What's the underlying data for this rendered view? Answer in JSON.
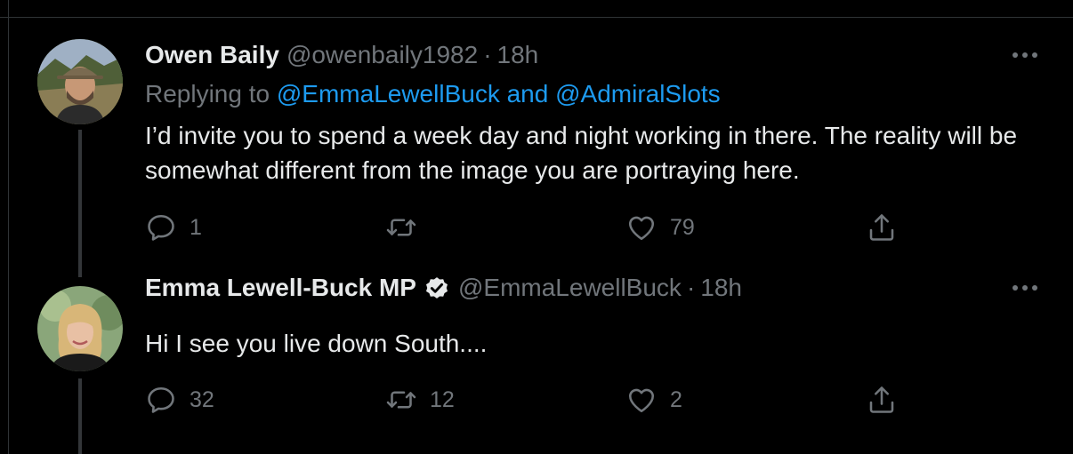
{
  "tweets": [
    {
      "author_name": "Owen Baily",
      "author_handle": "@owenbaily1982",
      "separator": "·",
      "time": "18h",
      "replying_to_prefix": "Replying to",
      "replying_to_mentions": "@EmmaLewellBuck and @AdmiralSlots",
      "text": "I’d invite you to spend a week day and night working in there. The reality will be somewhat different from the image you are portraying here.",
      "reply_count": "1",
      "retweet_count": "",
      "like_count": "79",
      "verified": false,
      "avatar_icon": "man-with-hat-outdoors-avatar"
    },
    {
      "author_name": "Emma Lewell-Buck MP",
      "author_handle": "@EmmaLewellBuck",
      "separator": "·",
      "time": "18h",
      "text": "Hi I see you live down South....",
      "reply_count": "32",
      "retweet_count": "12",
      "like_count": "2",
      "verified": true,
      "avatar_icon": "woman-blonde-avatar"
    }
  ],
  "icons": {
    "more": "more-horizontal-icon",
    "reply": "reply-bubble-icon",
    "retweet": "retweet-icon",
    "like": "heart-icon",
    "share": "share-icon",
    "verified": "verified-badge-icon"
  },
  "colors": {
    "background": "#000000",
    "text_primary": "#e7e9ea",
    "text_secondary": "#71767b",
    "link": "#1d9bf0",
    "divider": "#2f3336"
  }
}
